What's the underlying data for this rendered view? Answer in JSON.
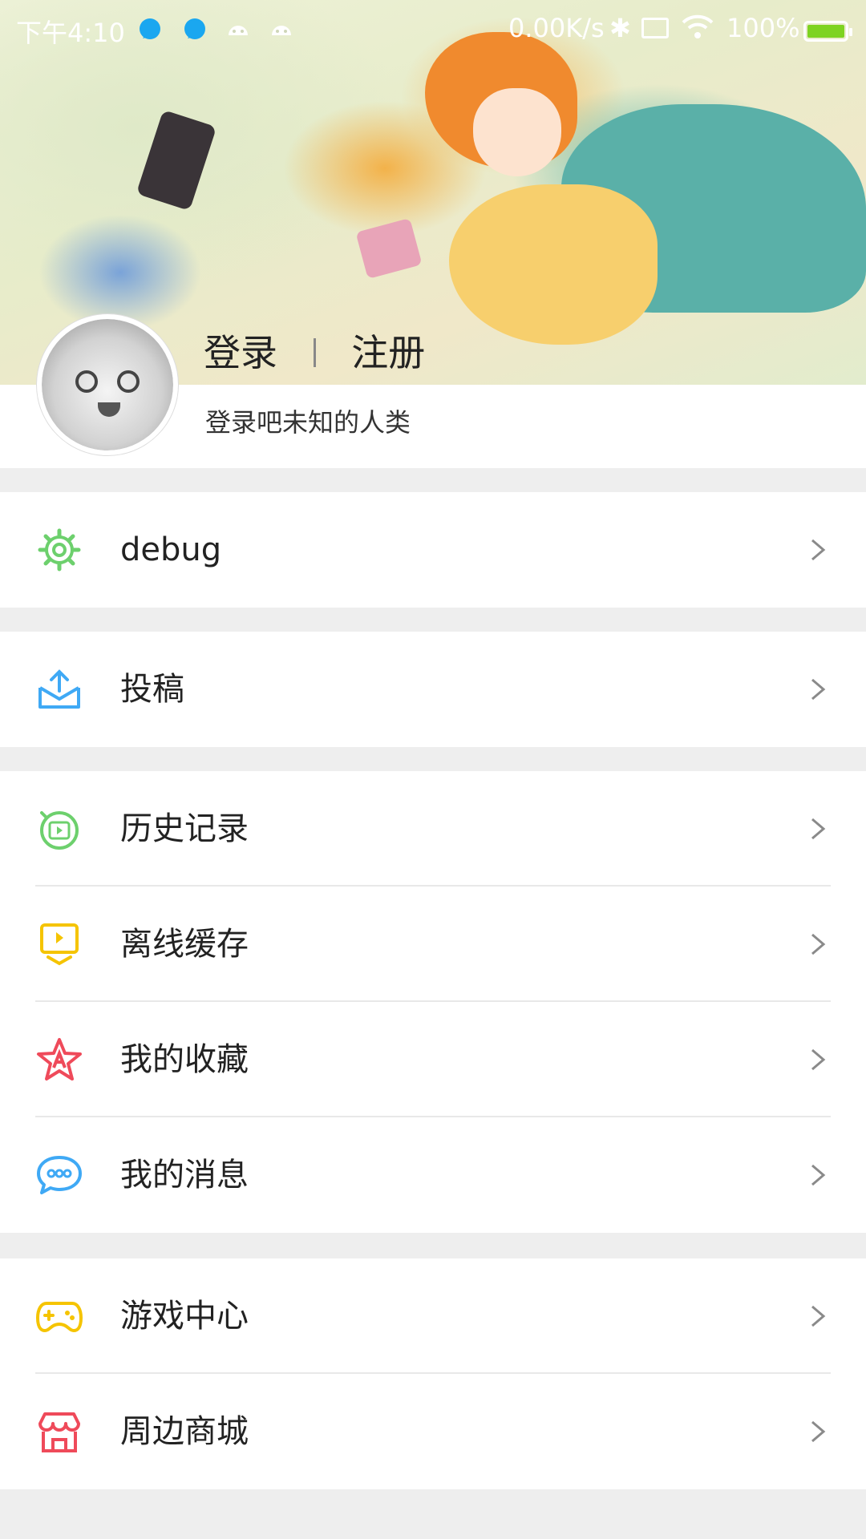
{
  "status_bar": {
    "time": "下午4:10",
    "network_speed": "0.00K/s",
    "battery": "100%"
  },
  "header": {
    "login": "登录",
    "register": "注册",
    "subtitle": "登录吧未知的人类"
  },
  "menu": {
    "debug": {
      "label": "debug",
      "icon": "gear-icon",
      "color": "#6dd06d"
    },
    "submit": {
      "label": "投稿",
      "icon": "upload-tray-icon",
      "color": "#3fa9f5"
    },
    "history": {
      "label": "历史记录",
      "icon": "history-play-icon",
      "color": "#6dd06d"
    },
    "offline": {
      "label": "离线缓存",
      "icon": "download-video-icon",
      "color": "#f5c400"
    },
    "favorites": {
      "label": "我的收藏",
      "icon": "star-icon",
      "color": "#ef4a5a"
    },
    "messages": {
      "label": "我的消息",
      "icon": "chat-bubble-icon",
      "color": "#3fa9f5"
    },
    "games": {
      "label": "游戏中心",
      "icon": "gamepad-icon",
      "color": "#f5c400"
    },
    "shop": {
      "label": "周边商城",
      "icon": "store-icon",
      "color": "#ef4a5a"
    }
  }
}
